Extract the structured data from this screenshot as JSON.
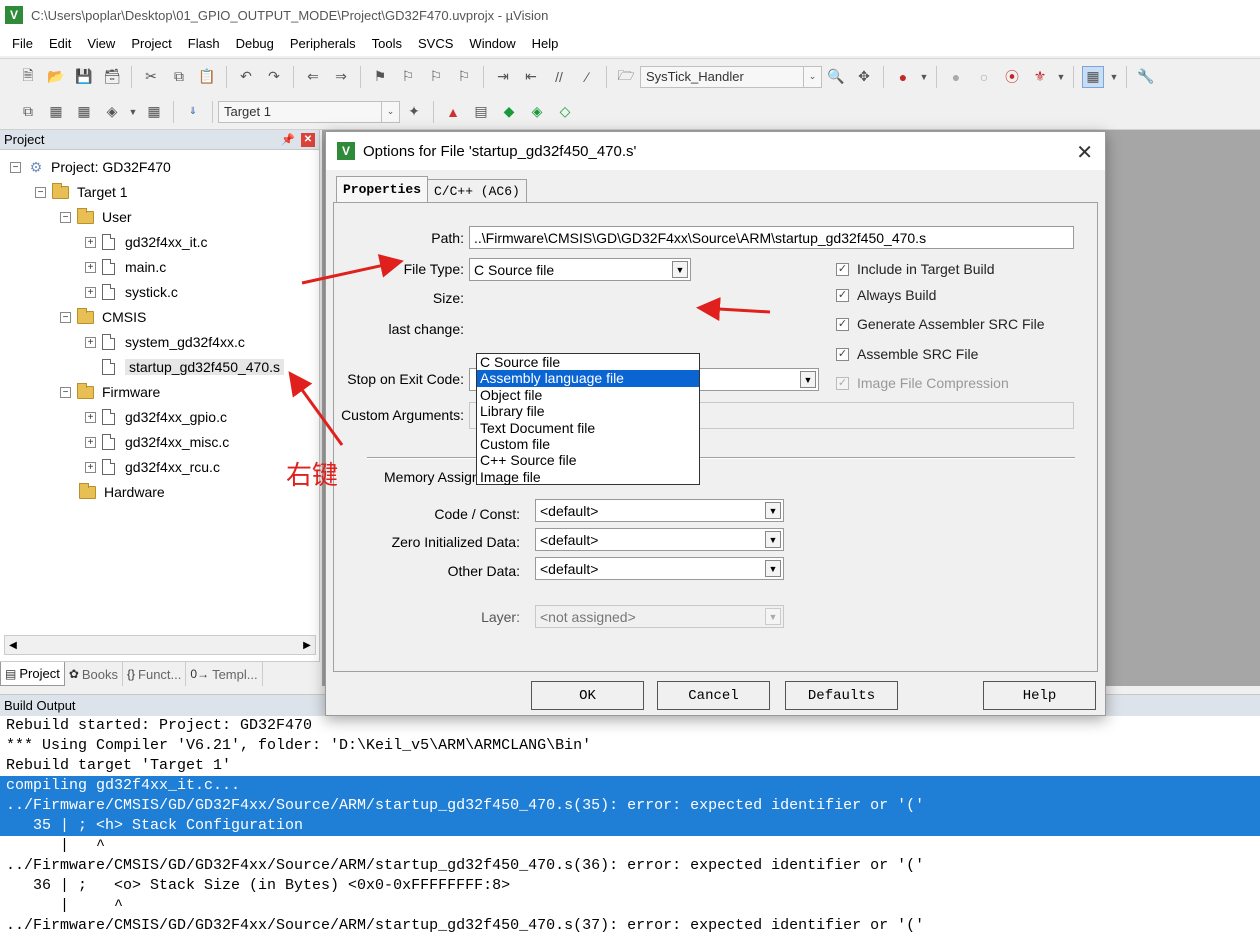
{
  "window": {
    "title": "C:\\Users\\poplar\\Desktop\\01_GPIO_OUTPUT_MODE\\Project\\GD32F470.uvprojx - µVision",
    "app_icon": "V"
  },
  "menu": [
    "File",
    "Edit",
    "View",
    "Project",
    "Flash",
    "Debug",
    "Peripherals",
    "Tools",
    "SVCS",
    "Window",
    "Help"
  ],
  "toolbar": {
    "function_combo": "SysTick_Handler",
    "target_combo": "Target 1"
  },
  "project_panel": {
    "title": "Project",
    "tree": {
      "root": "Project: GD32F470",
      "target": "Target 1",
      "groups": [
        {
          "name": "User",
          "files": [
            "gd32f4xx_it.c",
            "main.c",
            "systick.c"
          ]
        },
        {
          "name": "CMSIS",
          "files": [
            "system_gd32f4xx.c",
            "startup_gd32f450_470.s"
          ]
        },
        {
          "name": "Firmware",
          "files": [
            "gd32f4xx_gpio.c",
            "gd32f4xx_misc.c",
            "gd32f4xx_rcu.c"
          ]
        },
        {
          "name": "Hardware",
          "files": []
        }
      ]
    },
    "tabs": [
      "Project",
      "Books",
      "Funct...",
      "Templ..."
    ]
  },
  "build_output": {
    "title": "Build Output",
    "lines": [
      "Rebuild started: Project: GD32F470",
      "*** Using Compiler 'V6.21', folder: 'D:\\Keil_v5\\ARM\\ARMCLANG\\Bin'",
      "Rebuild target 'Target 1'",
      "compiling gd32f4xx_it.c...",
      "../Firmware/CMSIS/GD/GD32F4xx/Source/ARM/startup_gd32f450_470.s(35): error: expected identifier or '('",
      "   35 | ; <h> Stack Configuration",
      "      |   ^",
      "../Firmware/CMSIS/GD/GD32F4xx/Source/ARM/startup_gd32f450_470.s(36): error: expected identifier or '('",
      "   36 | ;   <o> Stack Size (in Bytes) <0x0-0xFFFFFFFF:8>",
      "      |     ^",
      "../Firmware/CMSIS/GD/GD32F4xx/Source/ARM/startup_gd32f450_470.s(37): error: expected identifier or '('"
    ]
  },
  "dialog": {
    "title": "Options for File 'startup_gd32f450_470.s'",
    "tabs": [
      "Properties",
      "C/C++ (AC6)"
    ],
    "path_label": "Path:",
    "path_value": "..\\Firmware\\CMSIS\\GD\\GD32F4xx\\Source\\ARM\\startup_gd32f450_470.s",
    "file_type_label": "File Type:",
    "file_type_value": "C Source file",
    "file_type_options": [
      "C Source file",
      "Assembly language file",
      "Object file",
      "Library file",
      "Text Document file",
      "Custom file",
      "C++ Source file",
      "Image file"
    ],
    "highlighted_option": "Assembly language file",
    "size_label": "Size:",
    "last_change_label": "last change:",
    "stop_label": "Stop on Exit Code:",
    "custom_args_label": "Custom Arguments:",
    "checkboxes": [
      {
        "label": "Include in Target Build",
        "checked": true,
        "enabled": true
      },
      {
        "label": "Always Build",
        "checked": true,
        "enabled": true
      },
      {
        "label": "Generate Assembler SRC File",
        "checked": true,
        "enabled": true
      },
      {
        "label": "Assemble SRC File",
        "checked": true,
        "enabled": true
      },
      {
        "label": "Image File Compression",
        "checked": true,
        "enabled": false
      }
    ],
    "memory_title": "Memory Assignment:",
    "code_const_label": "Code / Const:",
    "code_const_value": "<default>",
    "zero_init_label": "Zero Initialized Data:",
    "zero_init_value": "<default>",
    "other_data_label": "Other Data:",
    "other_data_value": "<default>",
    "layer_label": "Layer:",
    "layer_value": "<not assigned>",
    "buttons": {
      "ok": "OK",
      "cancel": "Cancel",
      "defaults": "Defaults",
      "help": "Help"
    }
  },
  "annotation": {
    "text": "右键",
    "color": "#e0201c"
  }
}
